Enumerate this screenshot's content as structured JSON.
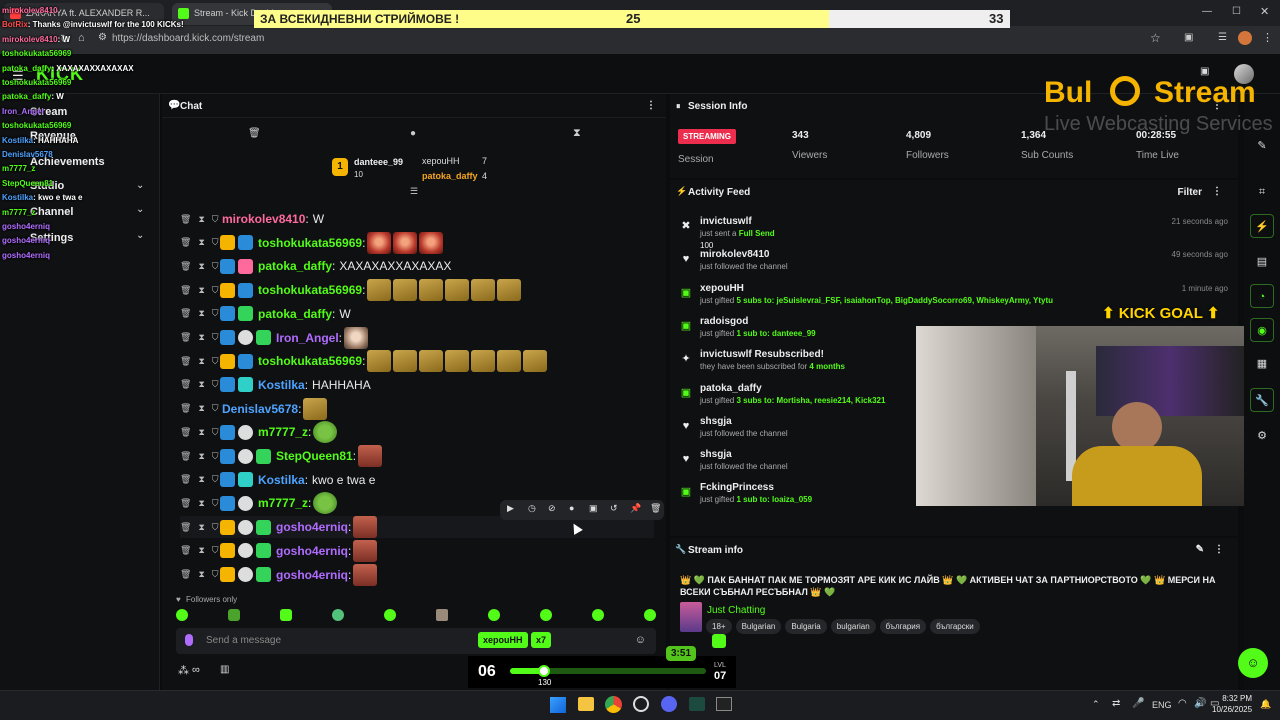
{
  "browser": {
    "tabs": [
      {
        "label": "ZAKARYA ft. ALEXANDER R..."
      },
      {
        "label": "Stream - Kick Dashbo..."
      }
    ],
    "url": "https://dashboard.kick.com/stream"
  },
  "kick": {
    "logo": "KICK"
  },
  "sidebar": {
    "items": [
      {
        "label": "Stream"
      },
      {
        "label": "Revenue"
      },
      {
        "label": "Achievements"
      },
      {
        "label": "Studio"
      },
      {
        "label": "Channel"
      },
      {
        "label": "Settings"
      }
    ]
  },
  "chat": {
    "title": "Chat",
    "leaderboard": {
      "first": {
        "rank": "1",
        "name": "danteee_99",
        "count": "10"
      },
      "second": {
        "name": "xepouHH",
        "count": "7"
      },
      "third": {
        "name": "patoka_daffy",
        "count": "4"
      }
    },
    "messages": [
      {
        "user": "mirokolev8410",
        "color": "#ff6a9d",
        "text": "W"
      },
      {
        "user": "toshokukata56969",
        "color": "#53fc18",
        "text": ""
      },
      {
        "user": "patoka_daffy",
        "color": "#53fc18",
        "text": "XAXAXAXXAXAXAX"
      },
      {
        "user": "toshokukata56969",
        "color": "#53fc18",
        "text": ""
      },
      {
        "user": "patoka_daffy",
        "color": "#53fc18",
        "text": "W"
      },
      {
        "user": "Iron_Angel",
        "color": "#b06cff",
        "text": ""
      },
      {
        "user": "toshokukata56969",
        "color": "#53fc18",
        "text": ""
      },
      {
        "user": "Kostilka",
        "color": "#4ea3ff",
        "text": "HAHHAHA"
      },
      {
        "user": "Denislav5678",
        "color": "#4ea3ff",
        "text": ""
      },
      {
        "user": "m7777_z",
        "color": "#53fc18",
        "text": ""
      },
      {
        "user": "StepQueen81",
        "color": "#53fc18",
        "text": ""
      },
      {
        "user": "Kostilka",
        "color": "#4ea3ff",
        "text": "kwo e twa e"
      },
      {
        "user": "m7777_z",
        "color": "#53fc18",
        "text": ""
      },
      {
        "user": "gosho4erniq",
        "color": "#b06cff",
        "text": ""
      },
      {
        "user": "gosho4erniq",
        "color": "#b06cff",
        "text": ""
      },
      {
        "user": "gosho4erniq",
        "color": "#b06cff",
        "text": ""
      }
    ],
    "followers_only": "Followers only",
    "input_placeholder": "Send a message"
  },
  "session": {
    "title": "Session Info",
    "status_badge": "STREAMING",
    "session_label": "Session",
    "viewers": {
      "value": "343",
      "label": "Viewers"
    },
    "followers": {
      "value": "4,809",
      "label": "Followers"
    },
    "subs": {
      "value": "1,364",
      "label": "Sub Counts"
    },
    "time": {
      "value": "00:28:55",
      "label": "Time Live"
    }
  },
  "activity": {
    "title": "Activity Feed",
    "filter_label": "Filter",
    "items": [
      {
        "user": "invictuswlf",
        "pre": "just sent a ",
        "hl": "Full Send",
        "post": "",
        "extra": "100",
        "time": "21 seconds ago",
        "icon": "kick-icon"
      },
      {
        "user": "mirokolev8410",
        "pre": "just followed the channel",
        "hl": "",
        "post": "",
        "extra": "",
        "time": "49 seconds ago",
        "icon": "heart-icon"
      },
      {
        "user": "xepouHH",
        "pre": "just gifted ",
        "hl": "5",
        "post": " subs to: jeSuislevrai_FSF, isaiahonTop, BigDaddySocorro69, WhiskeyArmy, Ytytu",
        "extra": "",
        "time": "1 minute ago",
        "icon": "gift-icon"
      },
      {
        "user": "radoisgod",
        "pre": "just gifted ",
        "hl": "1",
        "post": " sub to: danteee_99",
        "extra": "",
        "time": "",
        "icon": "gift-icon"
      },
      {
        "user": "invictuswlf Resubscribed!",
        "pre": "they have been subscribed for ",
        "hl": "4",
        "post": " months",
        "extra": "",
        "time": "",
        "icon": "star-icon"
      },
      {
        "user": "patoka_daffy",
        "pre": "just gifted ",
        "hl": "3",
        "post": " subs to: Mortisha, reesie214, Kick321",
        "extra": "",
        "time": "",
        "icon": "gift-icon"
      },
      {
        "user": "shsgja",
        "pre": "just followed the channel",
        "hl": "",
        "post": "",
        "extra": "",
        "time": "",
        "icon": "heart-icon"
      },
      {
        "user": "shsgja",
        "pre": "just followed the channel",
        "hl": "",
        "post": "",
        "extra": "",
        "time": "",
        "icon": "heart-icon"
      },
      {
        "user": "FckingPrincess",
        "pre": "just gifted ",
        "hl": "1",
        "post": " sub to: loaiza_059",
        "extra": "",
        "time": "",
        "icon": "gift-icon"
      }
    ]
  },
  "stream_info": {
    "title": "Stream info",
    "stream_title": "👑 💚 ПАК БАННАТ ПАК МЕ ТОРМОЗЯТ АРЕ КИК ИС ЛАЙВ 👑 💚 АКТИВЕН ЧАТ ЗА ПАРТНИОРСТВОТО 💚 👑 МЕРСИ НА ВСЕКИ СЪБНАЛ РЕСЪБНАЛ 👑 💚",
    "category": "Just Chatting",
    "tags": [
      "18+",
      "Bulgarian",
      "Bulgaria",
      "bulgarian",
      "българия",
      "български"
    ]
  },
  "overlay": {
    "goal_label": "ЗА ВСЕКИДНЕВНИ СТРИЙМОВЕ !",
    "goal_current": "25",
    "goal_target": "33",
    "goal_progress": 0.76,
    "brand_top": "Bul",
    "brand_name": "Stream",
    "brand_sub": "Live Webcasting Services",
    "kick_goal": "KICK GOAL",
    "level_left": "06",
    "level_right_label": "LVL",
    "level_right": "07",
    "xp_value": "130",
    "timer": "3:51",
    "pill_user": "xepouHH",
    "pill_multi": "x7",
    "overlay_chat": [
      {
        "user": "mirokolev8410",
        "text": ""
      },
      {
        "user": "BotRix",
        "text": ": Thanks @invictuswlf for the 100 KICKs!"
      },
      {
        "user": "mirokolev8410",
        "text": ": W"
      },
      {
        "user": "toshokukata56969",
        "text": ""
      },
      {
        "user": "patoka_daffy",
        "text": ": XAXAXAXXAXAXAX"
      },
      {
        "user": "toshokukata56969",
        "text": ""
      },
      {
        "user": "patoka_daffy",
        "text": ": W"
      },
      {
        "user": "Iron_Angel",
        "text": ""
      },
      {
        "user": "toshokukata56969",
        "text": ""
      },
      {
        "user": "Kostilka",
        "text": ": HAHHAHA"
      },
      {
        "user": "Denislav5678",
        "text": ""
      },
      {
        "user": "m7777_z",
        "text": ""
      },
      {
        "user": "StepQueen81",
        "text": ""
      },
      {
        "user": "Kostilka",
        "text": ": kwo e twa e"
      },
      {
        "user": "m7777_z",
        "text": ""
      },
      {
        "user": "gosho4erniq",
        "text": ""
      },
      {
        "user": "gosho4erniq",
        "text": ""
      },
      {
        "user": "gosho4erniq",
        "text": ""
      }
    ]
  },
  "taskbar": {
    "lang": "ENG",
    "time": "8:32 PM",
    "date": "10/26/2025"
  }
}
